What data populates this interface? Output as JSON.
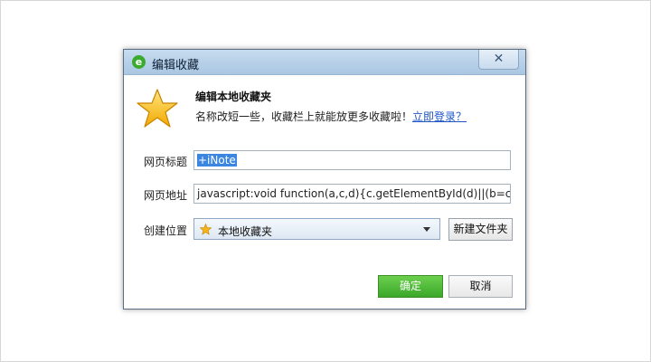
{
  "dialog": {
    "title": "编辑收藏",
    "close_symbol": "✕",
    "header_title": "编辑本地收藏夹",
    "header_desc": "名称改短一些，收藏栏上就能放更多收藏啦！",
    "login_link": "立即登录？"
  },
  "form": {
    "title_label": "网页标题",
    "title_value": "+iNote",
    "url_label": "网页地址",
    "url_value": "javascript:void function(a,c,d){c.getElementById(d)||(b=c.crea",
    "location_label": "创建位置",
    "location_value": "本地收藏夹",
    "new_folder_label": "新建文件夹"
  },
  "buttons": {
    "ok_label": "确定",
    "cancel_label": "取消"
  },
  "icons": {
    "app_logo": "browser-logo-icon",
    "star": "star-icon",
    "folder_star": "folder-star-icon",
    "dropdown": "chevron-down-icon"
  },
  "colors": {
    "accent_green": "#3aa72a",
    "link_blue": "#1f56c9",
    "selection_blue": "#3a86e0",
    "titlebar": "#a9c6e2"
  }
}
